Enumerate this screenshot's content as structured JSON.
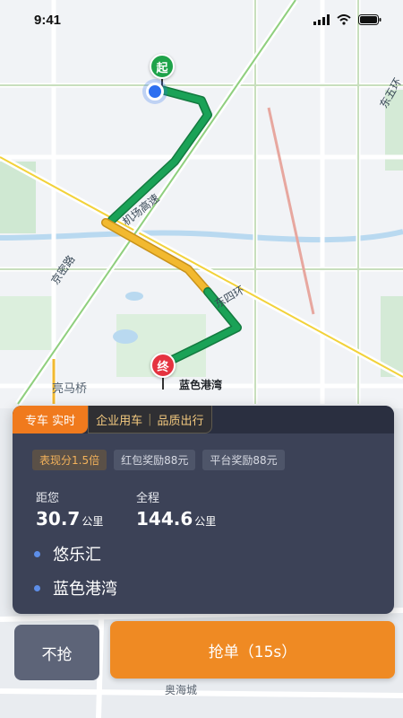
{
  "status_bar": {
    "time": "9:41"
  },
  "map": {
    "roads": {
      "airport_expressway": "机场高速",
      "jingmi_road": "京密路",
      "north_east_4th_ring": "东四环",
      "north_east_5th_ring": "东五环"
    },
    "places": {
      "liangmaqiao": "亮马桥",
      "aohai_city": "奥海城"
    },
    "start_pin": "起",
    "end_pin": "终",
    "destination_label": "蓝色港湾",
    "colors": {
      "route_green": "#1aa257",
      "route_yellow": "#f2b930",
      "start_pin": "#1fa34a",
      "end_pin": "#e53340"
    }
  },
  "order_card": {
    "tabs": {
      "primary": "专车 实时",
      "secondary": [
        "企业用车",
        "品质出行"
      ]
    },
    "badges": [
      "表现分1.5倍",
      "红包奖励88元",
      "平台奖励88元"
    ],
    "distance_to_you": {
      "label": "距您",
      "value": "30.7",
      "unit": "公里"
    },
    "total_distance": {
      "label": "全程",
      "value": "144.6",
      "unit": "公里"
    },
    "pickup": "悠乐汇",
    "dropoff": "蓝色港湾"
  },
  "actions": {
    "skip_label": "不抢",
    "grab_label": "抢单（15s）",
    "accent_color": "#ef8a23"
  }
}
